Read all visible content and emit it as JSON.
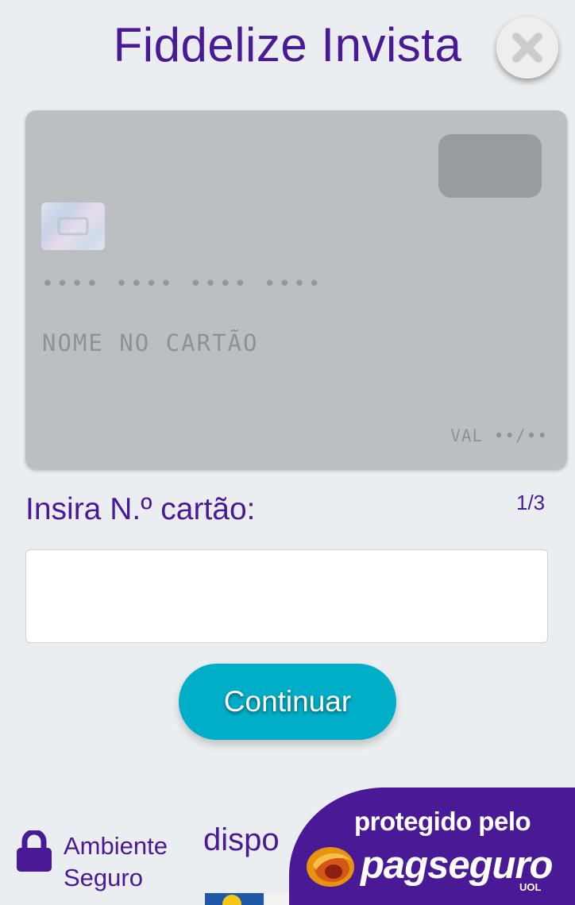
{
  "header": {
    "title": "Fiddelize Invista",
    "close_icon": "close-x-icon"
  },
  "card_preview": {
    "number_placeholder": "•••• •••• •••• ••••",
    "name_placeholder": "NOME NO CARTÃO",
    "expiry_placeholder": "VAL ••/••",
    "chip_icon": "card-chip-icon"
  },
  "form": {
    "step_label": "Insira N.º cartão:",
    "step_counter": "1/3",
    "card_number_value": "",
    "card_number_placeholder": ""
  },
  "actions": {
    "continue_label": "Continuar"
  },
  "footer": {
    "secure_label": "Ambiente Seguro",
    "secure_icon": "lock-icon",
    "partial_text": "dispo",
    "badge_line1": "protegido pelo",
    "badge_brand": "pagseguro",
    "badge_sub": "UOL"
  },
  "colors": {
    "brand_purple": "#4a1996",
    "accent_cyan": "#00aec8",
    "background": "#ebeef0",
    "card_gray": "#bbbfc1"
  }
}
